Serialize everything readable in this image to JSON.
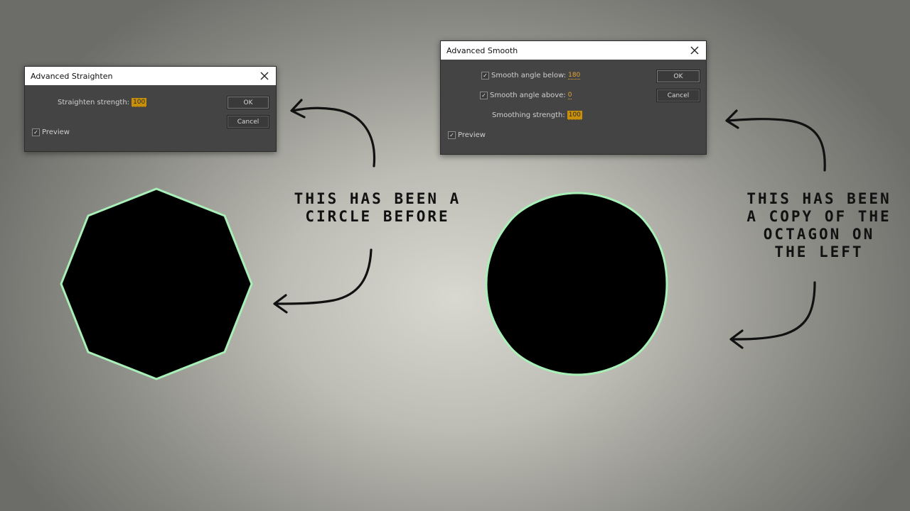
{
  "straighten_dialog": {
    "title": "Advanced Straighten",
    "strength_label": "Straighten strength:",
    "strength_value": "100",
    "ok_label": "OK",
    "cancel_label": "Cancel",
    "preview_label": "Preview",
    "preview_checked": "✓"
  },
  "smooth_dialog": {
    "title": "Advanced Smooth",
    "angle_below_label": "Smooth angle below:",
    "angle_below_value": "180",
    "angle_above_label": "Smooth angle above:",
    "angle_above_value": "0",
    "strength_label": "Smoothing strength:",
    "strength_value": "100",
    "ok_label": "OK",
    "cancel_label": "Cancel",
    "preview_label": "Preview",
    "checked_mark": "✓"
  },
  "annotations": {
    "left_note_line1": "THIS HAS BEEN A",
    "left_note_line2": "CIRCLE BEFORE",
    "right_note_line1": "THIS HAS BEEN",
    "right_note_line2": "A COPY OF THE",
    "right_note_line3": "OCTAGON ON",
    "right_note_line4": "THE LEFT"
  },
  "colors": {
    "shape_fill": "#000000",
    "shape_outline": "#a8f0b8",
    "accent_value": "#c8900a"
  }
}
